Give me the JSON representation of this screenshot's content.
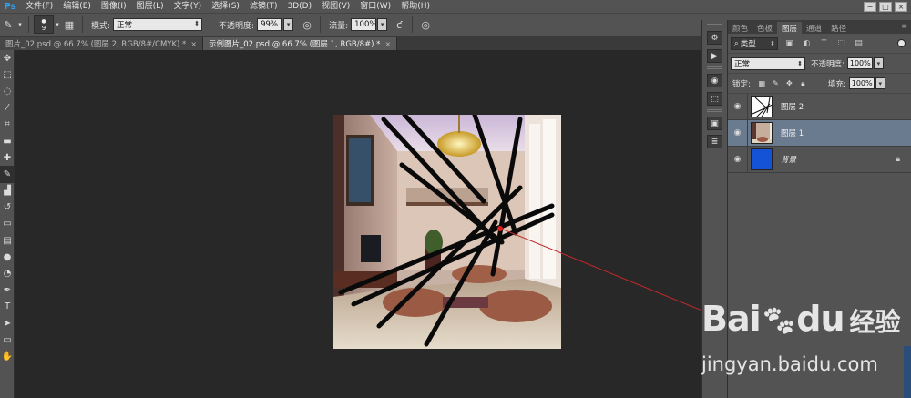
{
  "app": {
    "logo": "Ps"
  },
  "menu": [
    "文件(F)",
    "编辑(E)",
    "图像(I)",
    "图层(L)",
    "文字(Y)",
    "选择(S)",
    "滤镜(T)",
    "3D(D)",
    "视图(V)",
    "窗口(W)",
    "帮助(H)"
  ],
  "window_controls": {
    "minimize": "−",
    "restore": "□",
    "close": "×"
  },
  "options": {
    "brush_size": "9",
    "mode_label": "模式:",
    "mode_value": "正常",
    "opacity_label": "不透明度:",
    "opacity_value": "99%",
    "flow_label": "流量:",
    "flow_value": "100%",
    "dropdown_glyph": "▾"
  },
  "tabs": [
    {
      "label": "图片_02.psd @ 66.7% (图层 2, RGB/8#/CMYK) *",
      "close": "×"
    },
    {
      "label": "示例图片_02.psd @ 66.7% (图层 1, RGB/8#) *",
      "close": "×"
    }
  ],
  "panel": {
    "tabs": [
      "颜色",
      "色板",
      "图层",
      "通道",
      "路径"
    ],
    "active_tab": 2,
    "menu_glyph": "≡",
    "filter_kind": "类型",
    "blend_mode": "正常",
    "opacity_label": "不透明度:",
    "opacity_value": "100%",
    "lock_label": "锁定:",
    "fill_label": "填充:",
    "fill_value": "100%"
  },
  "layers": [
    {
      "name": "图层 2",
      "selected": false
    },
    {
      "name": "图层 1",
      "selected": true
    },
    {
      "name": "背景",
      "selected": false,
      "locked": true
    }
  ],
  "watermark": {
    "logo_latin": "Bai",
    "logo_paw": "du",
    "logo_cn": "经验",
    "url": "jingyan.baidu.com"
  },
  "colors": {
    "accent_blue": "#2fa1f0",
    "selected_layer": "#6a7a8f",
    "background_layer_fill": "#1452d6",
    "annotation_line": "#c0282c"
  }
}
